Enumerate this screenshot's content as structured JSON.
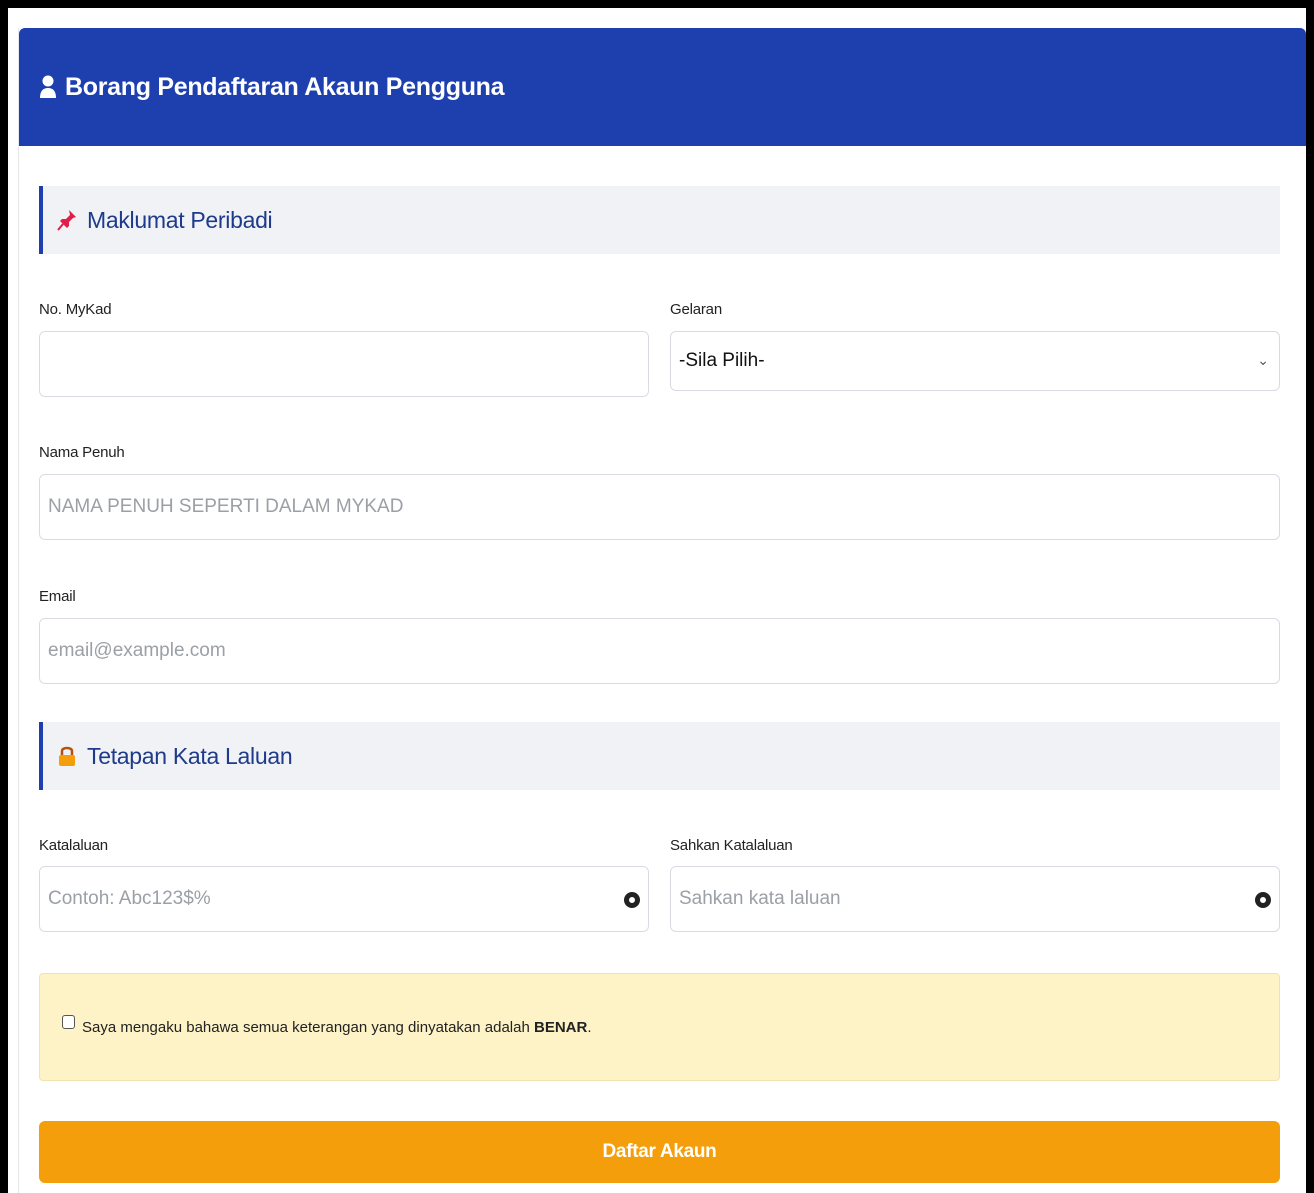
{
  "header": {
    "title": "Borang Pendaftaran Akaun Pengguna",
    "icon": "user-icon"
  },
  "section_personal": {
    "title": "Maklumat Peribadi",
    "icon": "pushpin-icon"
  },
  "mykad": {
    "label": "No. MyKad",
    "value": "",
    "placeholder": ""
  },
  "gelaran": {
    "label": "Gelaran",
    "selected": "-Sila Pilih-"
  },
  "nama": {
    "label": "Nama Penuh",
    "placeholder": "NAMA PENUH SEPERTI DALAM MYKAD"
  },
  "email": {
    "label": "Email",
    "placeholder": "email@example.com"
  },
  "section_password": {
    "title": "Tetapan Kata Laluan",
    "icon": "lock-icon"
  },
  "password": {
    "label": "Katalaluan",
    "placeholder": "Contoh: Abc123$%"
  },
  "confirm_password": {
    "label": "Sahkan Katalaluan",
    "placeholder": "Sahkan kata laluan"
  },
  "declaration": {
    "text_before": "Saya mengaku bahawa semua keterangan yang dinyatakan adalah ",
    "text_bold": "BENAR",
    "text_after": "."
  },
  "submit": {
    "label": "Daftar Akaun"
  },
  "colors": {
    "header": "#1e40af",
    "submit": "#f59e0b",
    "notice": "#fef3c7"
  }
}
